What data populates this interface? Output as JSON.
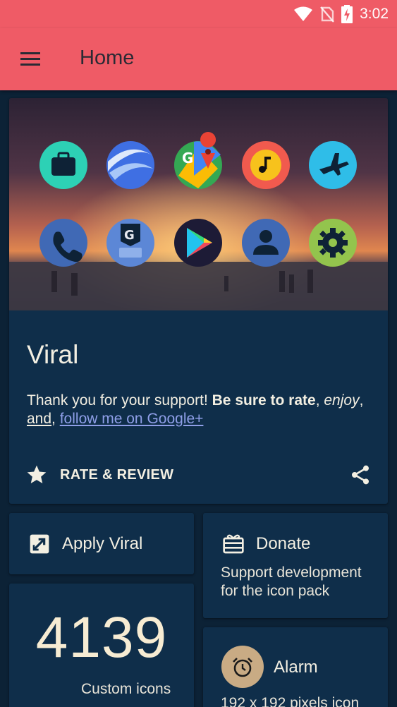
{
  "status_bar": {
    "time": "3:02",
    "icons": [
      "wifi-icon",
      "no-sim-icon",
      "battery-charging-icon"
    ]
  },
  "app_bar": {
    "title": "Home",
    "menu_icon": "hamburger-menu-icon"
  },
  "hero_card": {
    "title": "Viral",
    "text_plain": "Thank you for your support! ",
    "text_bold": "Be sure to rate",
    "text_comma": ", ",
    "text_italic": "enjoy",
    "text_comma2": ",",
    "text_and": "and",
    "text_comma3": ", ",
    "link": "follow me on Google+",
    "rate_label": "RATE & REVIEW",
    "rate_icon": "star-icon",
    "share_icon": "share-icon",
    "icons_row1": [
      "briefcase-icon",
      "google-earth-icon",
      "google-maps-icon",
      "music-icon",
      "airplane-icon"
    ],
    "icons_row2": [
      "phone-icon",
      "gboard-icon",
      "play-store-icon",
      "contacts-icon",
      "settings-icon"
    ]
  },
  "apply_tile": {
    "label": "Apply Viral",
    "icon": "apply-icon"
  },
  "donate_tile": {
    "label": "Donate",
    "icon": "gift-card-icon",
    "description": "Support development for the icon pack"
  },
  "count_tile": {
    "number": "4139",
    "caption": "Custom icons"
  },
  "alarm_tile": {
    "label": "Alarm",
    "icon": "alarm-icon",
    "description": "192 x 192 pixels icon"
  },
  "colors": {
    "accent": "#ef5b66",
    "card": "#0f2e4a",
    "background": "#0c2236",
    "link": "#8f9fe8"
  }
}
